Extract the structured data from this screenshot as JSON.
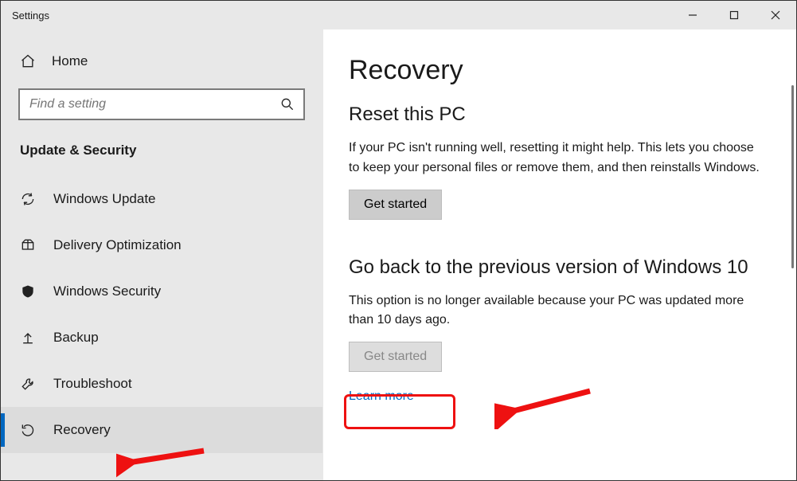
{
  "window": {
    "title": "Settings"
  },
  "sidebar": {
    "home": "Home",
    "search_placeholder": "Find a setting",
    "category": "Update & Security",
    "items": [
      {
        "label": "Windows Update"
      },
      {
        "label": "Delivery Optimization"
      },
      {
        "label": "Windows Security"
      },
      {
        "label": "Backup"
      },
      {
        "label": "Troubleshoot"
      },
      {
        "label": "Recovery"
      }
    ]
  },
  "main": {
    "title": "Recovery",
    "reset": {
      "heading": "Reset this PC",
      "text": "If your PC isn't running well, resetting it might help. This lets you choose to keep your personal files or remove them, and then reinstalls Windows.",
      "button": "Get started"
    },
    "goback": {
      "heading": "Go back to the previous version of Windows 10",
      "text": "This option is no longer available because your PC was updated more than 10 days ago.",
      "button": "Get started",
      "link": "Learn more"
    }
  }
}
